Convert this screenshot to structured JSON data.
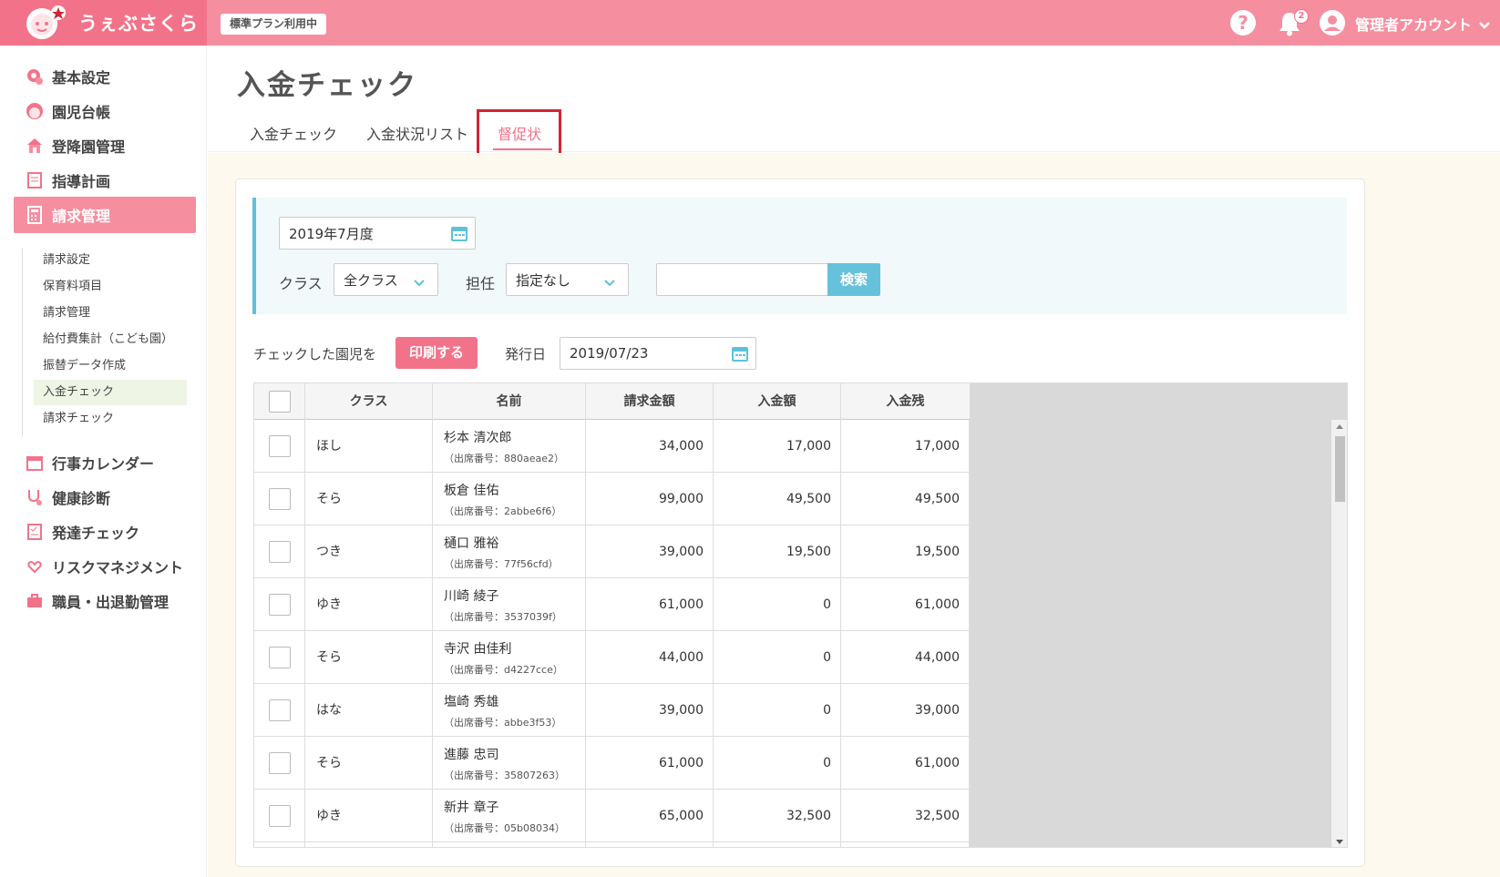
{
  "app": {
    "name": "うぇぶさくら",
    "plan_badge": "標準プラン利用中"
  },
  "header": {
    "help_icon": "?",
    "notification_count": "2",
    "user_name": "管理者アカウント"
  },
  "sidebar": {
    "items": [
      {
        "label": "基本設定",
        "icon": "gear-icon"
      },
      {
        "label": "園児台帳",
        "icon": "child-face-icon"
      },
      {
        "label": "登降園管理",
        "icon": "school-icon"
      },
      {
        "label": "指導計画",
        "icon": "notebook-icon"
      },
      {
        "label": "請求管理",
        "icon": "calculator-icon"
      },
      {
        "label": "行事カレンダー",
        "icon": "calendar-icon"
      },
      {
        "label": "健康診断",
        "icon": "stethoscope-icon"
      },
      {
        "label": "発達チェック",
        "icon": "checklist-icon"
      },
      {
        "label": "リスクマネジメント",
        "icon": "hands-heart-icon"
      },
      {
        "label": "職員・出退勤管理",
        "icon": "briefcase-icon"
      }
    ],
    "sub_items": [
      {
        "label": "請求設定"
      },
      {
        "label": "保育料項目"
      },
      {
        "label": "請求管理"
      },
      {
        "label": "給付費集計（こども園）"
      },
      {
        "label": "振替データ作成"
      },
      {
        "label": "入金チェック"
      },
      {
        "label": "請求チェック"
      }
    ]
  },
  "page": {
    "title": "入金チェック"
  },
  "tabs": [
    {
      "label": "入金チェック"
    },
    {
      "label": "入金状況リスト"
    },
    {
      "label": "督促状"
    }
  ],
  "filters": {
    "month_value": "2019年7月度",
    "class_label": "クラス",
    "class_value": "全クラス",
    "teacher_label": "担任",
    "teacher_value": "指定なし",
    "search_placeholder": "",
    "search_button": "検索"
  },
  "actions": {
    "checked_label": "チェックした園児を",
    "print_button": "印刷する",
    "issue_date_label": "発行日",
    "issue_date_value": "2019/07/23"
  },
  "table": {
    "headers": [
      "クラス",
      "名前",
      "請求金額",
      "入金額",
      "入金残"
    ],
    "rows": [
      {
        "class": "ほし",
        "name": "杉本 清次郎",
        "attendance": "（出席番号：880aeae2）",
        "billed": "34,000",
        "paid": "17,000",
        "remaining": "17,000"
      },
      {
        "class": "そら",
        "name": "板倉 佳佑",
        "attendance": "（出席番号：2abbe6f6）",
        "billed": "99,000",
        "paid": "49,500",
        "remaining": "49,500"
      },
      {
        "class": "つき",
        "name": "樋口 雅裕",
        "attendance": "（出席番号：77f56cfd）",
        "billed": "39,000",
        "paid": "19,500",
        "remaining": "19,500"
      },
      {
        "class": "ゆき",
        "name": "川崎 綾子",
        "attendance": "（出席番号：3537039f）",
        "billed": "61,000",
        "paid": "0",
        "remaining": "61,000"
      },
      {
        "class": "そら",
        "name": "寺沢 由佳利",
        "attendance": "（出席番号：d4227cce）",
        "billed": "44,000",
        "paid": "0",
        "remaining": "44,000"
      },
      {
        "class": "はな",
        "name": "塩崎 秀雄",
        "attendance": "（出席番号：abbe3f53）",
        "billed": "39,000",
        "paid": "0",
        "remaining": "39,000"
      },
      {
        "class": "そら",
        "name": "進藤 忠司",
        "attendance": "（出席番号：35807263）",
        "billed": "61,000",
        "paid": "0",
        "remaining": "61,000"
      },
      {
        "class": "ゆき",
        "name": "新井 章子",
        "attendance": "（出席番号：05b08034）",
        "billed": "65,000",
        "paid": "32,500",
        "remaining": "32,500"
      }
    ]
  },
  "colors": {
    "brand_pink": "#f27389",
    "header_pink": "#f58fa0",
    "accent_blue": "#5fc1d9",
    "highlight_red": "#d22534"
  }
}
